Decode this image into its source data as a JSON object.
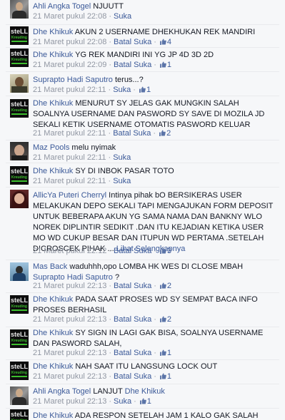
{
  "comments": [
    {
      "author": "Ahli Angka Togel",
      "text": " NJUUTT",
      "time": "21 Maret pukul 22:08",
      "like_label": "Suka",
      "likes": null
    },
    {
      "author": "Dhe Khikuk",
      "text": " AKUN 2 USERNAME DHEKHUKAN REK MANDIRI",
      "time": "21 Maret pukul 22:08",
      "like_label": "Batal Suka",
      "likes": "4"
    },
    {
      "author": "Dhe Khikuk",
      "text": " YG REK MANDIRI INI YG JP 4D 3D 2D",
      "time": "21 Maret pukul 22:09",
      "like_label": "Batal Suka",
      "likes": "1"
    },
    {
      "author": "Suprapto Hadi Saputro",
      "text": " terus...?",
      "time": "21 Maret pukul 22:11",
      "like_label": "Suka",
      "likes": "1"
    },
    {
      "author": "Dhe Khikuk",
      "text": " MENURUT SY JELAS GAK MUNGKIN SALAH SOALNYA USERNAME DAN PASWORD SY SAVE DI MOZILA JD SEKALI KETIK USERNAME OTOMATIS PASWORD KELUAR",
      "time": "21 Maret pukul 22:11",
      "like_label": "Batal Suka",
      "likes": "2"
    },
    {
      "author": "Maz Pools",
      "text": " melu nyimak",
      "time": "21 Maret pukul 22:11",
      "like_label": "Suka",
      "likes": null
    },
    {
      "author": "Dhe Khikuk",
      "text": " SY DI INBOK PASAR TOTO",
      "time": "21 Maret pukul 22:11",
      "like_label": "Suka",
      "likes": null
    },
    {
      "author": "AllicYa Puteri Cherryl",
      "text": " Intinya pihak bO BERSIKERAS USER MELAKUKAN DEPO SEKALI TAPI MENGAJUKAN FORM DEPOSIT UNTUK BEBERAPA AKUN YG SAMA NAMA DAN BANKNY WLO NOREK DIPLINTIR SEDIKIT .DAN ITU KEJADIAN KETIKA USER MO WD CUKUP BESAR DAN ITUPUN WD PERTAMA .SETELAH DICROSCEK PIHAK ...",
      "see_more": "Lihat Selengkapnya",
      "time": "21 Maret pukul 22:12",
      "like_label": "Batal Suka",
      "likes": "3"
    },
    {
      "author": "Mas Back",
      "text": " waduhhh,opo LOMBA HK WES DI CLOSE MBAH ",
      "tag": "Suprapto Hadi Saputro",
      "text_after": " ?",
      "time": "21 Maret pukul 22:13",
      "like_label": "Batal Suka",
      "likes": "2"
    },
    {
      "author": "Dhe Khikuk",
      "text": " PADA SAAT PROSES WD SY SEMPAT BACA INFO PROSES BERHASIL",
      "time": "21 Maret pukul 22:13",
      "like_label": "Batal Suka",
      "likes": "2"
    },
    {
      "author": "Dhe Khikuk",
      "text": " SY SIGN IN LAGI GAK BISA, SOALNYA USERNAME DAN PASWORD SALAH,",
      "time": "21 Maret pukul 22:13",
      "like_label": "Batal Suka",
      "likes": "1"
    },
    {
      "author": "Dhe Khikuk",
      "text": " NAH SAAT ITU LANGSUNG LOCK OUT",
      "time": "21 Maret pukul 22:13",
      "like_label": "Batal Suka",
      "likes": "1"
    },
    {
      "author": "Ahli Angka Togel",
      "text": " LANJUT ",
      "tag": "Dhe Khikuk",
      "time": "21 Maret pukul 22:13",
      "like_label": "Suka",
      "likes": "1"
    },
    {
      "author": "Dhe Khikuk",
      "text": " ADA RESPON SETELAH JAM 1 KALO GAK SALAH",
      "time": null,
      "like_label": null,
      "likes": null
    }
  ],
  "avatar_texts": {
    "stell_top": "steLL",
    "stell_bottom": "Kreuding"
  },
  "colors": {
    "link": "#3b5998",
    "meta": "#9197a3",
    "background": "#f6f7f9"
  }
}
